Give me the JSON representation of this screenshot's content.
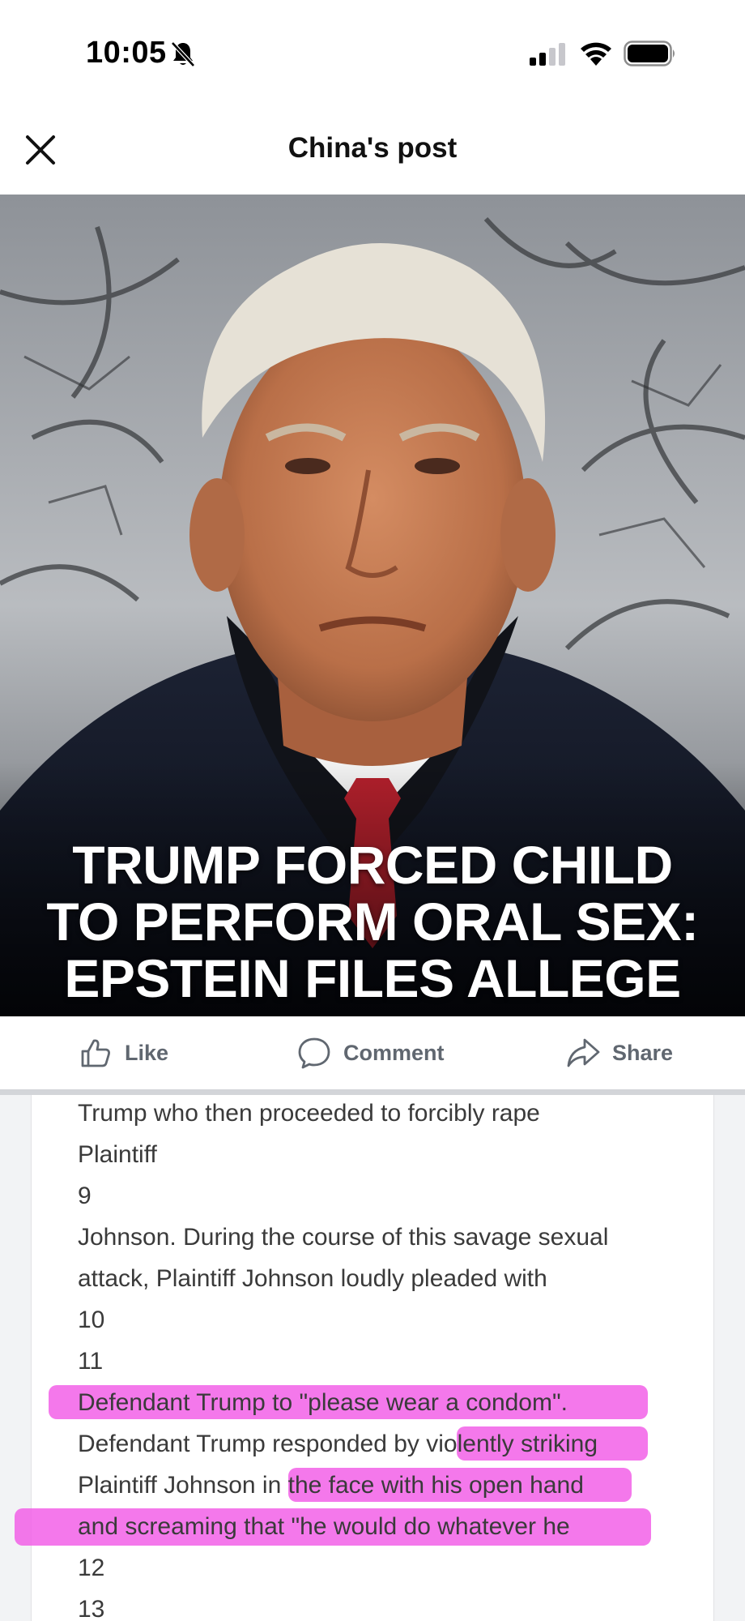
{
  "status_bar": {
    "time": "10:05",
    "icons": [
      "bell-muted-icon",
      "cellular-signal-icon",
      "wifi-icon",
      "battery-icon"
    ]
  },
  "header": {
    "title": "China's post",
    "close_icon": "close-icon"
  },
  "post_image": {
    "headline_lines": [
      "TRUMP FORCED CHILD",
      "TO PERFORM ORAL SEX:",
      "EPSTEIN FILES ALLEGE"
    ]
  },
  "actions": [
    {
      "label": "Like",
      "icon": "thumbs-up-icon"
    },
    {
      "label": "Comment",
      "icon": "comment-bubble-icon"
    },
    {
      "label": "Share",
      "icon": "share-arrow-icon"
    }
  ],
  "document": {
    "lines": [
      "Trump who then proceeded to forcibly rape",
      "Plaintiff",
      "9",
      "Johnson. During the course of this savage sexual",
      "attack, Plaintiff Johnson loudly pleaded with",
      "10",
      "11",
      "Defendant Trump to \"please wear a condom\".",
      "Defendant Trump responded by violently striking",
      "Plaintiff Johnson in the face with his open hand",
      "and screaming that \"he would do whatever he",
      "12",
      "13"
    ],
    "highlight_color": "#f25ae6"
  }
}
